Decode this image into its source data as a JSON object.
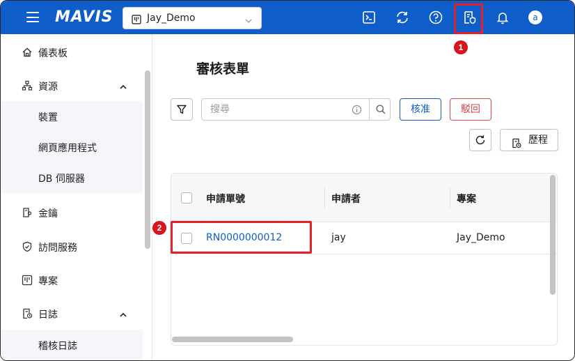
{
  "header": {
    "logo_text": "MAVIS",
    "project_selector": {
      "value": "Jay_Demo"
    },
    "icons": [
      "terminal-icon",
      "sync-icon",
      "help-icon",
      "approval-form-icon",
      "bell-icon"
    ],
    "avatar_letter": "a"
  },
  "annotations": {
    "marker_1": "1",
    "marker_2": "2",
    "highlight_color": "#e5202a"
  },
  "sidebar": {
    "items": [
      {
        "label": "儀表板",
        "icon": "home-icon"
      },
      {
        "label": "資源",
        "icon": "sitemap-icon",
        "expanded": true,
        "children": [
          "裝置",
          "網頁應用程式",
          "DB 伺服器"
        ]
      },
      {
        "label": "金鑰",
        "icon": "key-icon"
      },
      {
        "label": "訪問服務",
        "icon": "shield-icon"
      },
      {
        "label": "專案",
        "icon": "project-icon"
      },
      {
        "label": "日誌",
        "icon": "log-icon",
        "expanded": true,
        "children": [
          "稽核日誌"
        ]
      }
    ]
  },
  "main": {
    "title": "審核表單",
    "search": {
      "placeholder": "搜尋",
      "value": ""
    },
    "buttons": {
      "approve": "核准",
      "reject": "駁回",
      "history": "歷程"
    },
    "table": {
      "columns": [
        "申請單號",
        "申請者",
        "專案"
      ],
      "rows": [
        {
          "request_id": "RN0000000012",
          "applicant": "jay",
          "project": "Jay_Demo"
        }
      ]
    }
  },
  "colors": {
    "brand": "#0f5dc8",
    "danger": "#e0434b",
    "marker": "#d9141e"
  }
}
